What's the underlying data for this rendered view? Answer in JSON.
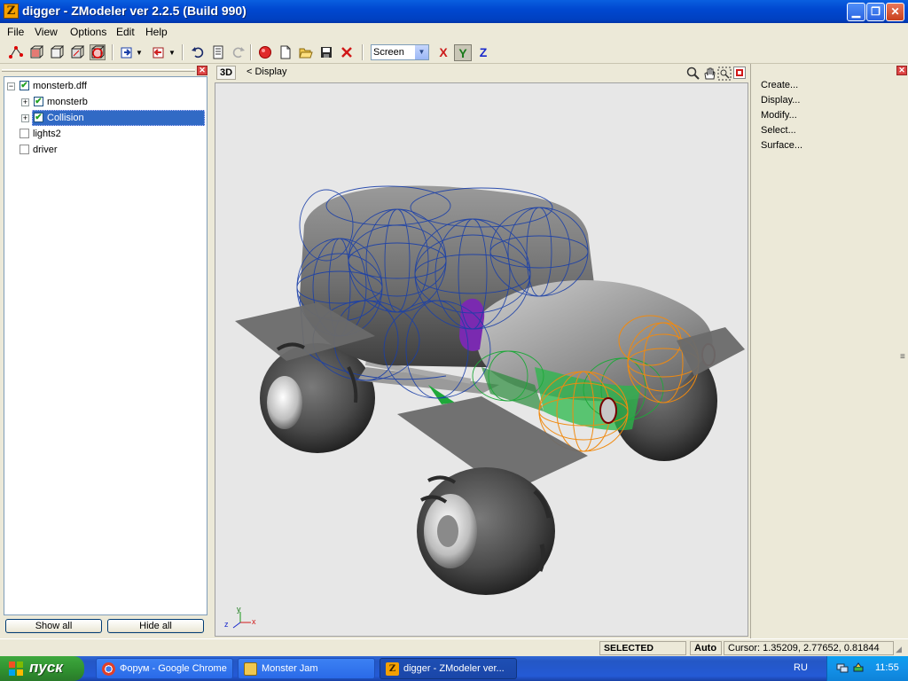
{
  "window": {
    "title": "digger - ZModeler ver 2.2.5 (Build 990)",
    "app_icon_letter": "Z"
  },
  "menu": [
    "File",
    "View",
    "Options",
    "Edit",
    "Help"
  ],
  "toolbar": {
    "view_mode": "Screen",
    "axes": [
      "X",
      "Y",
      "Z"
    ],
    "axis_colors": {
      "X": "#cc1a1a",
      "Y": "#1a7a1a",
      "Z": "#1a2acc"
    }
  },
  "tree": {
    "items": [
      {
        "label": "monsterb.dff",
        "checked": true,
        "expander": "−",
        "level": 0
      },
      {
        "label": "monsterb",
        "checked": true,
        "expander": "+",
        "level": 1
      },
      {
        "label": "Collision",
        "checked": true,
        "expander": "+",
        "level": 1,
        "selected": true
      },
      {
        "label": "lights2",
        "checked": false,
        "level": 0
      },
      {
        "label": "driver",
        "checked": false,
        "level": 0
      }
    ],
    "show_all_label": "Show all",
    "hide_all_label": "Hide all"
  },
  "viewport": {
    "mode_label": "3D",
    "display_label": "<  Display",
    "axis_gizmo": {
      "y": "y",
      "x": "x",
      "z": "z"
    }
  },
  "command_panel": {
    "items": [
      "Create...",
      "Display...",
      "Modify...",
      "Select...",
      "Surface..."
    ]
  },
  "statusbar": {
    "mode": "SELECTED MODE",
    "snap": "Auto",
    "cursor": "Cursor: 1.35209, 2.77652, 0.81844"
  },
  "taskbar": {
    "start_label": "пуск",
    "tasks": [
      {
        "label": "Форум - Google Chrome",
        "icon": "chrome-icon",
        "active": false
      },
      {
        "label": "Monster Jam",
        "icon": "folder-icon",
        "active": false
      },
      {
        "label": "digger - ZModeler ver...",
        "icon": "zmodeler-icon",
        "active": true
      }
    ],
    "language": "RU",
    "clock": "11:55"
  },
  "colors": {
    "title_blue": "#0048d0",
    "selection": "#316ac5",
    "wire_blue": "#1a3fa8",
    "wire_orange": "#f08a10",
    "wire_green": "#1fa83a"
  }
}
